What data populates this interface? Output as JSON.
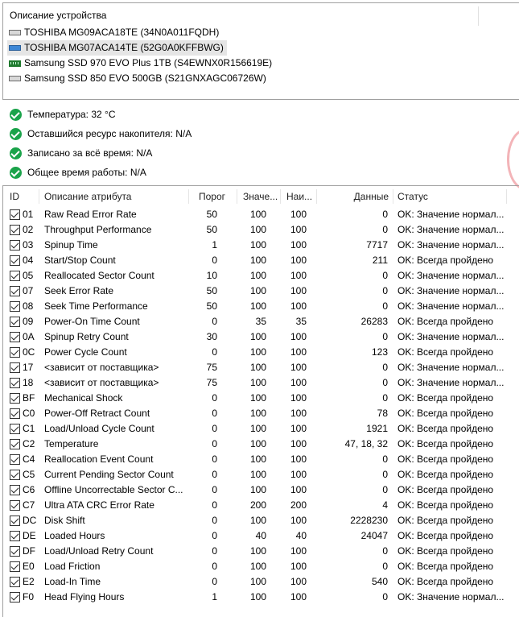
{
  "devices": {
    "header": "Описание устройства",
    "items": [
      {
        "label": "TOSHIBA MG09ACA18TE (34N0A011FQDH)",
        "icon": "hdd-icon"
      },
      {
        "label": "TOSHIBA MG07ACA14TE (52G0A0KFFBWG)",
        "icon": "hdd-icon",
        "selected": true
      },
      {
        "label": "Samsung SSD 970 EVO Plus 1TB (S4EWNX0R156619E)",
        "icon": "ssd-icon"
      },
      {
        "label": "Samsung SSD 850 EVO 500GB (S21GNXAGC06726W)",
        "icon": "hdd-icon"
      }
    ]
  },
  "status": [
    {
      "label": "Температура: 32 °C"
    },
    {
      "label": "Оставшийся ресурс накопителя: N/A"
    },
    {
      "label": "Записано за всё время: N/A"
    },
    {
      "label": "Общее время работы: N/A"
    }
  ],
  "table": {
    "columns": [
      "ID",
      "Описание атрибута",
      "Порог",
      "Значе...",
      "Наи...",
      "Данные",
      "Статус"
    ],
    "rows": [
      {
        "id": "01",
        "desc": "Raw Read Error Rate",
        "thr": "50",
        "val": "100",
        "worst": "100",
        "raw": "0",
        "status": "OK: Значение нормал..."
      },
      {
        "id": "02",
        "desc": "Throughput Performance",
        "thr": "50",
        "val": "100",
        "worst": "100",
        "raw": "0",
        "status": "OK: Значение нормал..."
      },
      {
        "id": "03",
        "desc": "Spinup Time",
        "thr": "1",
        "val": "100",
        "worst": "100",
        "raw": "7717",
        "status": "OK: Значение нормал..."
      },
      {
        "id": "04",
        "desc": "Start/Stop Count",
        "thr": "0",
        "val": "100",
        "worst": "100",
        "raw": "211",
        "status": "OK: Всегда пройдено"
      },
      {
        "id": "05",
        "desc": "Reallocated Sector Count",
        "thr": "10",
        "val": "100",
        "worst": "100",
        "raw": "0",
        "status": "OK: Значение нормал..."
      },
      {
        "id": "07",
        "desc": "Seek Error Rate",
        "thr": "50",
        "val": "100",
        "worst": "100",
        "raw": "0",
        "status": "OK: Значение нормал..."
      },
      {
        "id": "08",
        "desc": "Seek Time Performance",
        "thr": "50",
        "val": "100",
        "worst": "100",
        "raw": "0",
        "status": "OK: Значение нормал..."
      },
      {
        "id": "09",
        "desc": "Power-On Time Count",
        "thr": "0",
        "val": "35",
        "worst": "35",
        "raw": "26283",
        "status": "OK: Всегда пройдено"
      },
      {
        "id": "0A",
        "desc": "Spinup Retry Count",
        "thr": "30",
        "val": "100",
        "worst": "100",
        "raw": "0",
        "status": "OK: Значение нормал..."
      },
      {
        "id": "0C",
        "desc": "Power Cycle Count",
        "thr": "0",
        "val": "100",
        "worst": "100",
        "raw": "123",
        "status": "OK: Всегда пройдено"
      },
      {
        "id": "17",
        "desc": "<зависит от поставщика>",
        "thr": "75",
        "val": "100",
        "worst": "100",
        "raw": "0",
        "status": "OK: Значение нормал..."
      },
      {
        "id": "18",
        "desc": "<зависит от поставщика>",
        "thr": "75",
        "val": "100",
        "worst": "100",
        "raw": "0",
        "status": "OK: Значение нормал..."
      },
      {
        "id": "BF",
        "desc": "Mechanical Shock",
        "thr": "0",
        "val": "100",
        "worst": "100",
        "raw": "0",
        "status": "OK: Всегда пройдено"
      },
      {
        "id": "C0",
        "desc": "Power-Off Retract Count",
        "thr": "0",
        "val": "100",
        "worst": "100",
        "raw": "78",
        "status": "OK: Всегда пройдено"
      },
      {
        "id": "C1",
        "desc": "Load/Unload Cycle Count",
        "thr": "0",
        "val": "100",
        "worst": "100",
        "raw": "1921",
        "status": "OK: Всегда пройдено"
      },
      {
        "id": "C2",
        "desc": "Temperature",
        "thr": "0",
        "val": "100",
        "worst": "100",
        "raw": "47, 18, 32",
        "status": "OK: Всегда пройдено"
      },
      {
        "id": "C4",
        "desc": "Reallocation Event Count",
        "thr": "0",
        "val": "100",
        "worst": "100",
        "raw": "0",
        "status": "OK: Всегда пройдено"
      },
      {
        "id": "C5",
        "desc": "Current Pending Sector Count",
        "thr": "0",
        "val": "100",
        "worst": "100",
        "raw": "0",
        "status": "OK: Всегда пройдено"
      },
      {
        "id": "C6",
        "desc": "Offline Uncorrectable Sector C...",
        "thr": "0",
        "val": "100",
        "worst": "100",
        "raw": "0",
        "status": "OK: Всегда пройдено"
      },
      {
        "id": "C7",
        "desc": "Ultra ATA CRC Error Rate",
        "thr": "0",
        "val": "200",
        "worst": "200",
        "raw": "4",
        "status": "OK: Всегда пройдено"
      },
      {
        "id": "DC",
        "desc": "Disk Shift",
        "thr": "0",
        "val": "100",
        "worst": "100",
        "raw": "2228230",
        "status": "OK: Всегда пройдено"
      },
      {
        "id": "DE",
        "desc": "Loaded Hours",
        "thr": "0",
        "val": "40",
        "worst": "40",
        "raw": "24047",
        "status": "OK: Всегда пройдено"
      },
      {
        "id": "DF",
        "desc": "Load/Unload Retry Count",
        "thr": "0",
        "val": "100",
        "worst": "100",
        "raw": "0",
        "status": "OK: Всегда пройдено"
      },
      {
        "id": "E0",
        "desc": "Load Friction",
        "thr": "0",
        "val": "100",
        "worst": "100",
        "raw": "0",
        "status": "OK: Всегда пройдено"
      },
      {
        "id": "E2",
        "desc": "Load-In Time",
        "thr": "0",
        "val": "100",
        "worst": "100",
        "raw": "540",
        "status": "OK: Всегда пройдено"
      },
      {
        "id": "F0",
        "desc": "Head Flying Hours",
        "thr": "1",
        "val": "100",
        "worst": "100",
        "raw": "0",
        "status": "OK: Значение нормал..."
      }
    ]
  }
}
